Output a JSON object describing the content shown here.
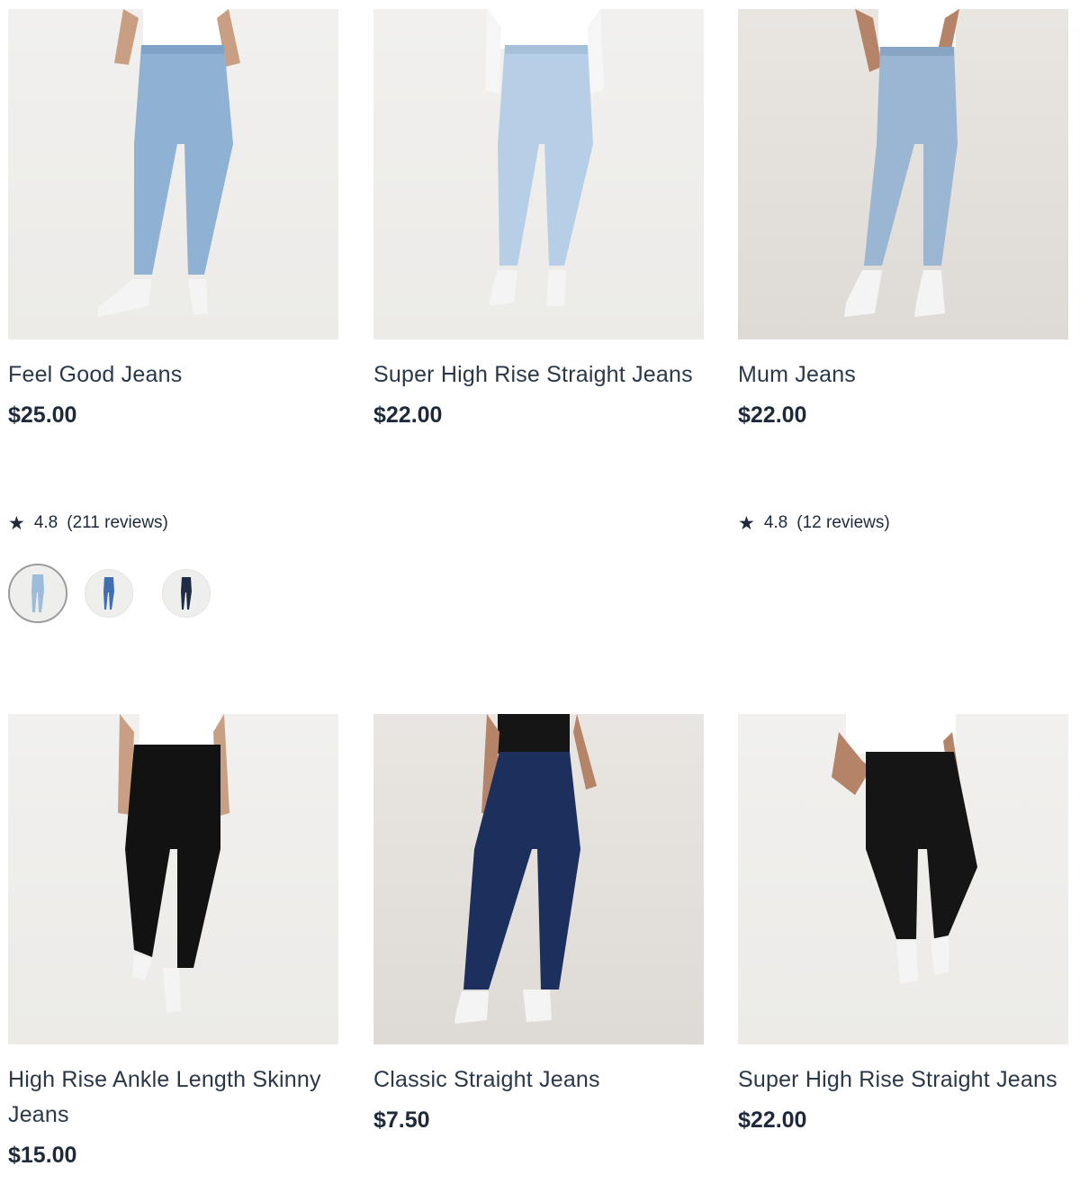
{
  "products": [
    {
      "name": "Feel Good Jeans",
      "price": "$25.00",
      "rating": "4.8",
      "reviews": "(211 reviews)",
      "image": "model-light-wash-skinny-jeans",
      "denim_color": "#8fb1d4",
      "swatch_colors": [
        "#9dbcdc",
        "#3f6fb0",
        "#1f2c45"
      ]
    },
    {
      "name": "Super High Rise Straight Jeans",
      "price": "$22.00",
      "image": "model-bleach-wash-straight-jeans",
      "denim_color": "#b7cfe6"
    },
    {
      "name": "Mum Jeans",
      "price": "$22.00",
      "rating": "4.8",
      "reviews": "(12 reviews)",
      "image": "model-light-wash-mum-jeans",
      "denim_color": "#9bb6d2"
    },
    {
      "name": "High Rise Ankle Length Skinny Jeans",
      "price": "$15.00",
      "image": "model-black-skinny-jeans",
      "denim_color": "#121212"
    },
    {
      "name": "Classic Straight Jeans",
      "price": "$7.50",
      "image": "model-dark-indigo-straight-jeans",
      "denim_color": "#1d2f5c"
    },
    {
      "name": "Super High Rise Straight Jeans",
      "price": "$22.00",
      "image": "model-black-straight-jeans",
      "denim_color": "#151515"
    }
  ],
  "icons": {
    "rating": "star-icon"
  }
}
